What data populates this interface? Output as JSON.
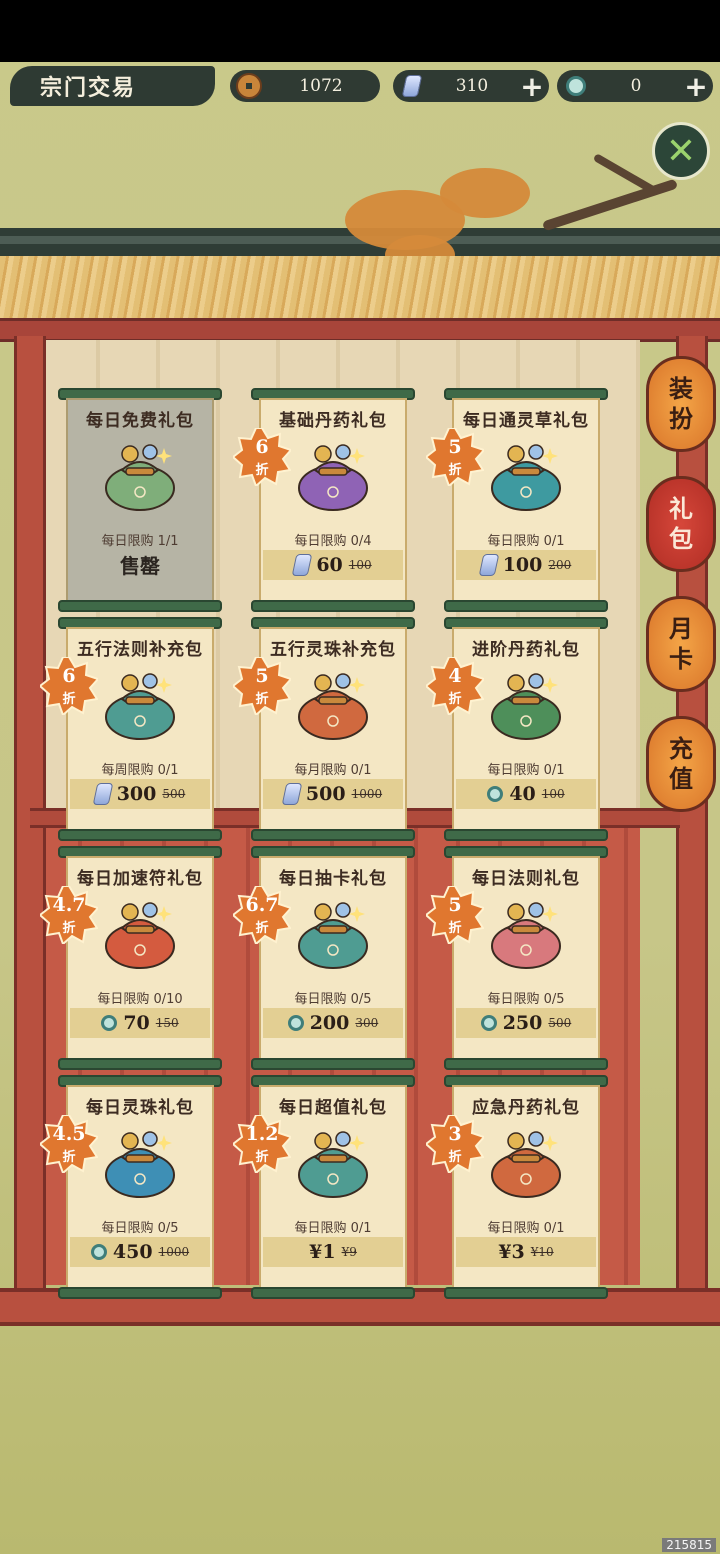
{
  "header": {
    "title": "宗门交易",
    "coins": "1072",
    "gems": "310",
    "jade": "0"
  },
  "side_tabs": [
    {
      "line1": "装",
      "line2": "扮",
      "active": false
    },
    {
      "line1": "礼",
      "line2": "包",
      "active": true
    },
    {
      "line1": "月",
      "line2": "卡",
      "active": false
    },
    {
      "line1": "充",
      "line2": "值",
      "active": false
    }
  ],
  "packs": [
    {
      "name": "每日免费礼包",
      "limit": "每日限购 1/1",
      "sold": "售罄",
      "discount": "",
      "currency": "",
      "price": "",
      "old": ""
    },
    {
      "name": "基础丹药礼包",
      "limit": "每日限购 0/4",
      "discount": "6",
      "currency": "gem",
      "price": "60",
      "old": "100"
    },
    {
      "name": "每日通灵草礼包",
      "limit": "每日限购 0/1",
      "discount": "5",
      "currency": "gem",
      "price": "100",
      "old": "200"
    },
    {
      "name": "五行法则补充包",
      "limit": "每周限购 0/1",
      "discount": "6",
      "currency": "gem",
      "price": "300",
      "old": "500"
    },
    {
      "name": "五行灵珠补充包",
      "limit": "每月限购 0/1",
      "discount": "5",
      "currency": "gem",
      "price": "500",
      "old": "1000"
    },
    {
      "name": "进阶丹药礼包",
      "limit": "每日限购 0/1",
      "discount": "4",
      "currency": "jade",
      "price": "40",
      "old": "100"
    },
    {
      "name": "每日加速符礼包",
      "limit": "每日限购 0/10",
      "discount": "4.7",
      "currency": "jade",
      "price": "70",
      "old": "150"
    },
    {
      "name": "每日抽卡礼包",
      "limit": "每日限购 0/5",
      "discount": "6.7",
      "currency": "jade",
      "price": "200",
      "old": "300"
    },
    {
      "name": "每日法则礼包",
      "limit": "每日限购 0/5",
      "discount": "5",
      "currency": "jade",
      "price": "250",
      "old": "500"
    },
    {
      "name": "每日灵珠礼包",
      "limit": "每日限购 0/5",
      "discount": "4.5",
      "currency": "jade",
      "price": "450",
      "old": "1000"
    },
    {
      "name": "每日超值礼包",
      "limit": "每日限购 0/1",
      "discount": "1.2",
      "currency": "yen",
      "price": "¥1",
      "old": "¥9"
    },
    {
      "name": "应急丹药礼包",
      "limit": "每日限购 0/1",
      "discount": "3",
      "currency": "yen",
      "price": "¥3",
      "old": "¥10"
    }
  ],
  "discount_suffix": "折",
  "colors": {
    "sack": [
      "#7fae7a",
      "#8f63b5",
      "#3e9aa0",
      "#4f9c92",
      "#d0693f",
      "#4e8f5a",
      "#d45b3f",
      "#4f9c92",
      "#d8797d",
      "#3e8fb5",
      "#4f9c92",
      "#d0693f"
    ],
    "badge": "#e0772f",
    "accent_red": "#b8503f"
  },
  "watermark": "215815"
}
